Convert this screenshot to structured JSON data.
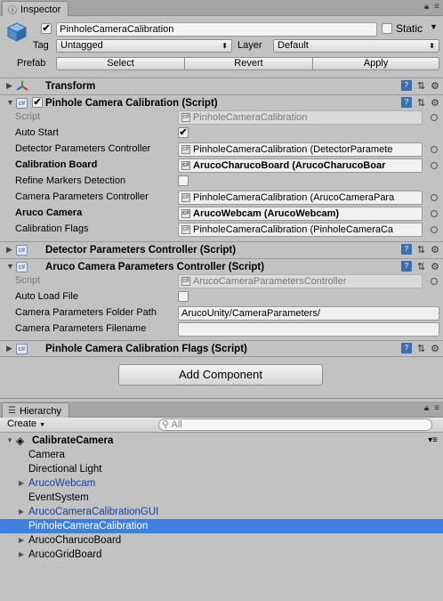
{
  "inspector_tab": {
    "label": "Inspector"
  },
  "object": {
    "active": "✔",
    "name": "PinholeCameraCalibration",
    "static_label": "Static",
    "tag_label": "Tag",
    "tag_value": "Untagged",
    "layer_label": "Layer",
    "layer_value": "Default",
    "prefab_label": "Prefab",
    "prefab_buttons": {
      "select": "Select",
      "revert": "Revert",
      "apply": "Apply"
    }
  },
  "transform": {
    "title": "Transform"
  },
  "calib_script": {
    "title": "Pinhole Camera Calibration (Script)",
    "rows": [
      {
        "label": "Script",
        "value": "PinholeCameraCalibration"
      },
      {
        "label": "Auto Start",
        "value": "✔"
      },
      {
        "label": "Detector Parameters Controller",
        "value": "PinholeCameraCalibration (DetectorParamete"
      },
      {
        "label": "Calibration Board",
        "value": "ArucoCharucoBoard (ArucoCharucoBoar"
      },
      {
        "label": "Refine Markers Detection",
        "value": ""
      },
      {
        "label": "Camera Parameters Controller",
        "value": "PinholeCameraCalibration (ArucoCameraPara"
      },
      {
        "label": "Aruco Camera",
        "value": "ArucoWebcam (ArucoWebcam)"
      },
      {
        "label": "Calibration Flags",
        "value": "PinholeCameraCalibration (PinholeCameraCa"
      }
    ]
  },
  "detector_script": {
    "title": "Detector Parameters Controller (Script)"
  },
  "camparams_script": {
    "title": "Aruco Camera Parameters Controller (Script)",
    "rows": [
      {
        "label": "Script",
        "value": "ArucoCameraParametersController"
      },
      {
        "label": "Auto Load File",
        "value": ""
      },
      {
        "label": "Camera Parameters Folder Path",
        "value": "ArucoUnity/CameraParameters/"
      },
      {
        "label": "Camera Parameters Filename",
        "value": ""
      }
    ]
  },
  "flags_script": {
    "title": "Pinhole Camera Calibration Flags (Script)"
  },
  "add_component": "Add Component",
  "hierarchy_tab": {
    "label": "Hierarchy"
  },
  "hierarchy": {
    "create_label": "Create",
    "search_placeholder": "All",
    "scene_name": "CalibrateCamera",
    "items": [
      {
        "name": "Camera"
      },
      {
        "name": "Directional Light"
      },
      {
        "name": "ArucoWebcam"
      },
      {
        "name": "EventSystem"
      },
      {
        "name": "ArucoCameraCalibrationGUI"
      },
      {
        "name": "PinholeCameraCalibration"
      },
      {
        "name": "ArucoCharucoBoard"
      },
      {
        "name": "ArucoGridBoard"
      }
    ]
  },
  "icons": {
    "lock": "lock-icon",
    "menu": "menu-icon",
    "help": "help-book-icon",
    "preset": "preset-icon",
    "gear": "gear-icon",
    "unity": "unity-scene-icon"
  },
  "colors": {
    "selection": "#3d80df",
    "prefab_text": "#1a3ea0",
    "panel_bg": "#c2c2c2"
  }
}
